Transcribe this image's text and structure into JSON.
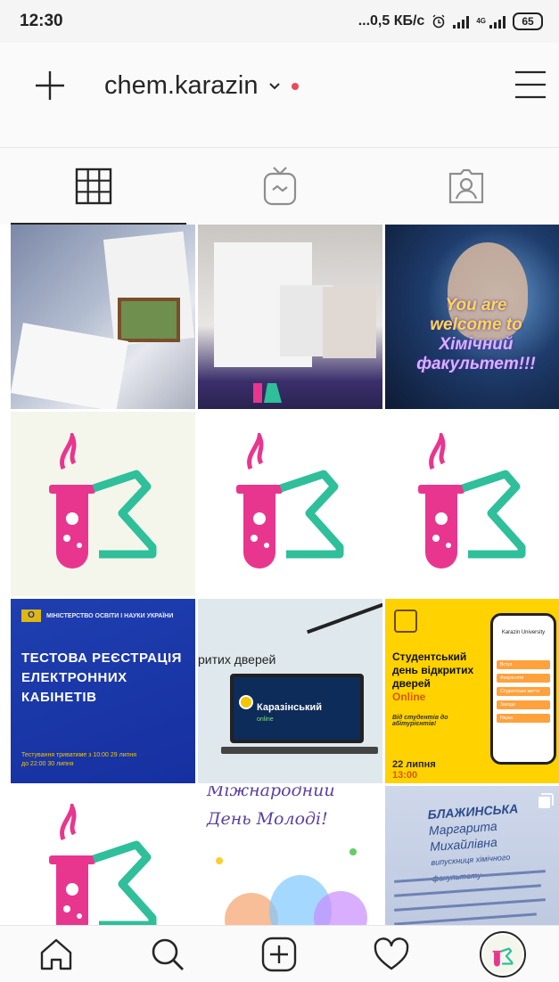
{
  "status_bar": {
    "time": "12:30",
    "speed": "...0,5 КБ/с",
    "network_tag": "4G",
    "battery": "65",
    "icons": [
      "alarm-icon",
      "signal-icon",
      "4g-signal-icon",
      "battery-icon"
    ]
  },
  "header": {
    "username": "chem.karazin",
    "icons": [
      "plus-icon",
      "chevron-down-icon",
      "notification-dot",
      "hamburger-menu-icon"
    ],
    "accent_dot_color": "#ed4956"
  },
  "tabs": [
    {
      "id": "grid",
      "icon": "grid-icon",
      "active": true
    },
    {
      "id": "igtv",
      "icon": "igtv-icon",
      "active": false
    },
    {
      "id": "tagged",
      "icon": "tagged-user-icon",
      "active": false
    }
  ],
  "posts": {
    "p7": {
      "ministry": "МІНІСТЕРСТВО ОСВІТИ І НАУКИ УКРАЇНИ",
      "headline_1": "ТЕСТОВА РЕЄСТРАЦІЯ",
      "headline_2": "ЕЛЕКТРОННИХ",
      "headline_3": "КАБІНЕТІВ",
      "footnote_1": "Тестування триватиме з 10:00 29 липня",
      "footnote_2": "до 22:00 30 липня"
    },
    "p8": {
      "title": "ритих дверей",
      "screen_title": "Каразінський",
      "screen_sub": "online"
    },
    "p9": {
      "title_1": "Студентський",
      "title_2": "день відкритих",
      "title_3": "дверей",
      "title_4": "Online",
      "subtitle": "Від студентів до абітурієнтів!",
      "date": "22 липня",
      "time": "13:00",
      "phone_header": "Karazin University",
      "phone_rows": [
        "Вступ",
        "Факультети",
        "Студентське життя",
        "Заходи",
        "Наука"
      ]
    },
    "p11": {
      "title_1": "Міжнародний",
      "title_2": "День Молоді!"
    },
    "p12": {
      "name_1": "БЛАЖИНСЬКА",
      "name_2": "Маргарита Михайлівна",
      "role": "випускниця хімічного факультету"
    },
    "p3": {
      "text_1": "You are",
      "text_2": "welcome to",
      "text_3": "Хімічний",
      "text_4": "факультет!!!"
    }
  },
  "bottom_nav": [
    {
      "id": "home",
      "icon": "home-icon"
    },
    {
      "id": "search",
      "icon": "search-icon"
    },
    {
      "id": "new_post",
      "icon": "new-post-icon"
    },
    {
      "id": "activity",
      "icon": "heart-icon"
    },
    {
      "id": "profile",
      "icon": "avatar"
    }
  ],
  "colors": {
    "logo_pink": "#e8368f",
    "logo_green": "#2fbf9a",
    "ministry_blue": "#1630a0",
    "event_yellow": "#ffd200"
  }
}
